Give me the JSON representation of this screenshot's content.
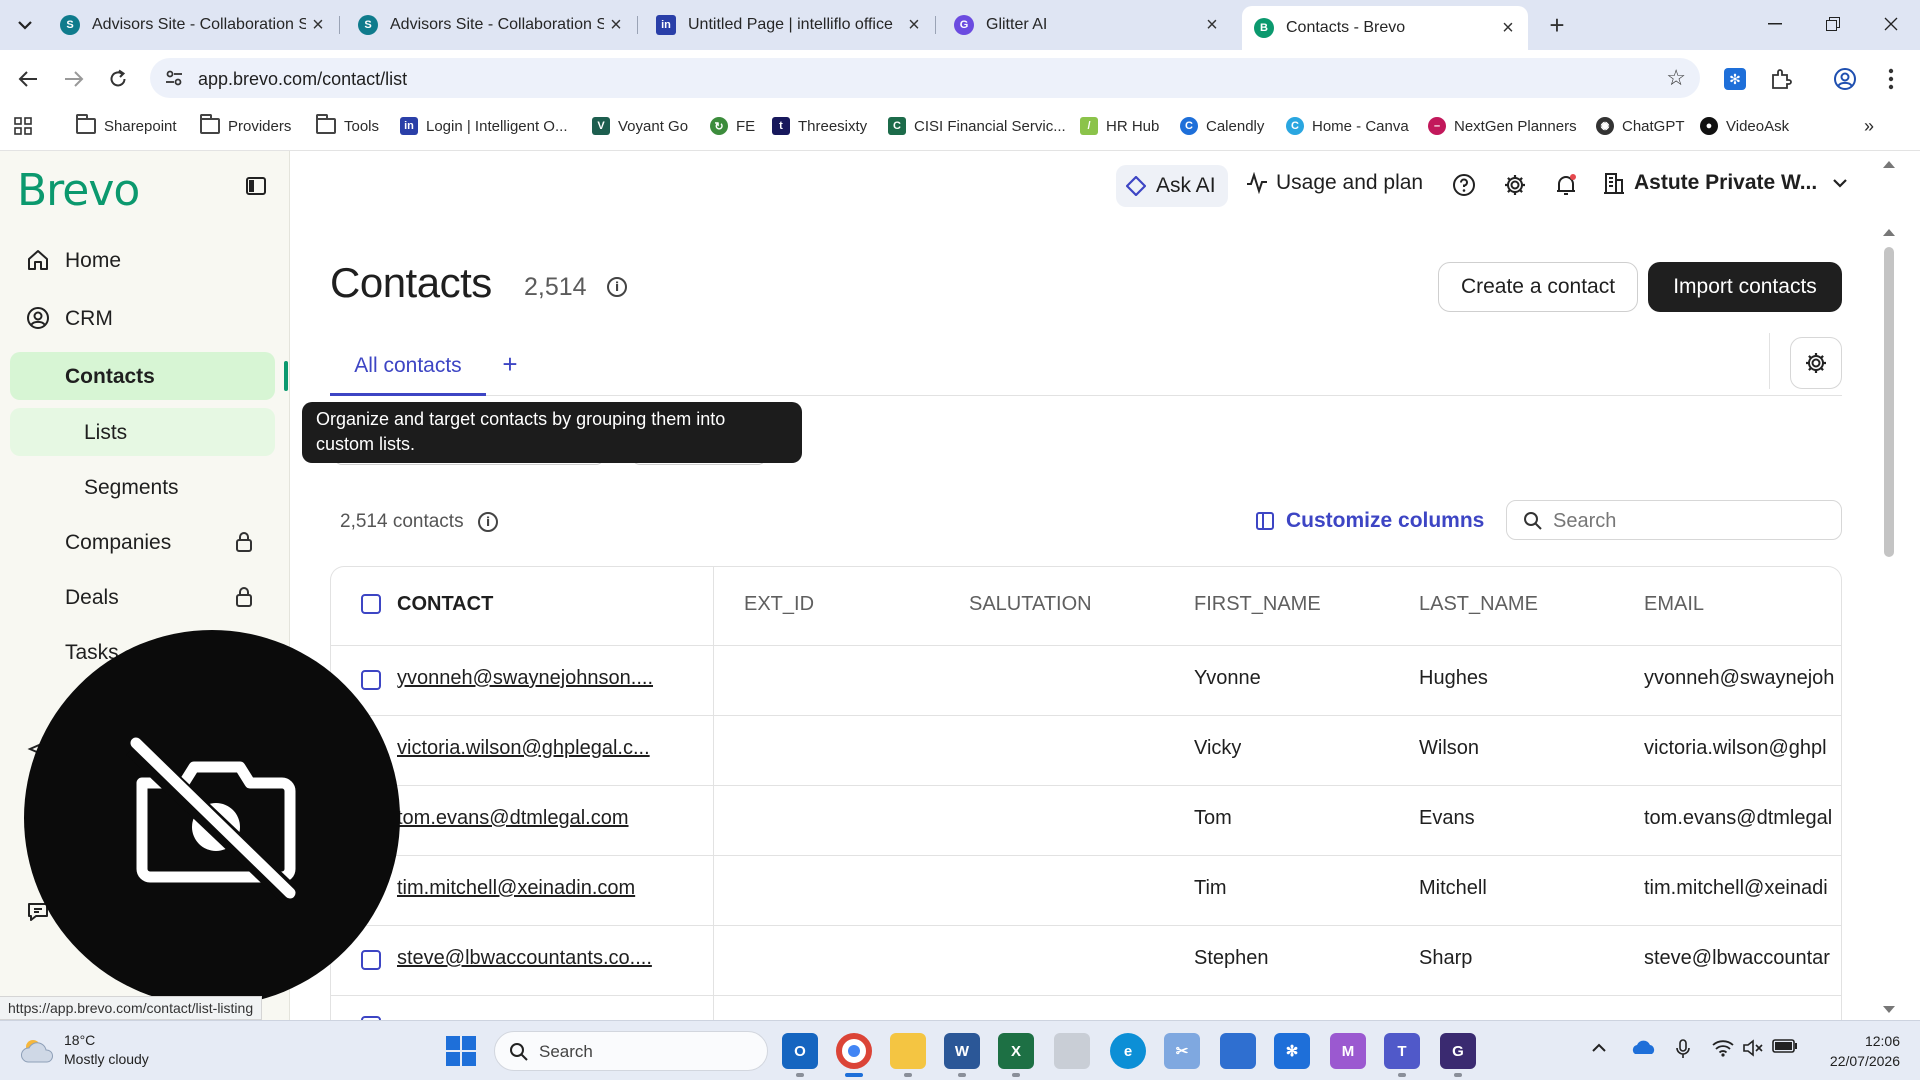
{
  "browser": {
    "tabs": [
      {
        "title": "Advisors Site - Collaboration Site",
        "active": false
      },
      {
        "title": "Advisors Site - Collaboration Site",
        "active": false
      },
      {
        "title": "Untitled Page | intelliflo office",
        "active": false
      },
      {
        "title": "Glitter AI",
        "active": false
      },
      {
        "title": "Contacts - Brevo",
        "active": true
      }
    ],
    "url": "app.brevo.com/contact/list",
    "bookmarks": [
      "Sharepoint",
      "Providers",
      "Tools",
      "Login | Intelligent O...",
      "Voyant Go",
      "FE",
      "Threesixty",
      "CISI Financial Servic...",
      "HR Hub",
      "Calendly",
      "Home - Canva",
      "NextGen Planners",
      "ChatGPT",
      "VideoAsk"
    ],
    "status_url": "https://app.brevo.com/contact/list-listing"
  },
  "colors": {
    "brand": "#0b996e",
    "accent": "#3d45c4",
    "selected_nav": "#d7f5d4"
  },
  "sidebar": {
    "logo": "Brevo",
    "items": [
      {
        "label": "Home",
        "icon": "home-icon"
      },
      {
        "label": "CRM",
        "icon": "user-circle-icon"
      },
      {
        "label": "Contacts",
        "selected": true
      },
      {
        "label": "Lists"
      },
      {
        "label": "Segments"
      },
      {
        "label": "Companies",
        "locked": true
      },
      {
        "label": "Deals",
        "locked": true
      },
      {
        "label": "Tasks"
      }
    ]
  },
  "header": {
    "ask_ai": "Ask AI",
    "usage": "Usage and plan",
    "account": "Astute Private W..."
  },
  "page": {
    "title": "Contacts",
    "count": "2,514",
    "create_button": "Create a contact",
    "import_button": "Import contacts",
    "tab_all": "All contacts",
    "tab_add": "+",
    "tooltip": "Organize and target contacts by grouping them into custom lists.",
    "contacts_count": "2,514 contacts",
    "customize_columns": "Customize columns",
    "search_placeholder": "Search"
  },
  "table": {
    "columns": [
      "CONTACT",
      "EXT_ID",
      "SALUTATION",
      "FIRST_NAME",
      "LAST_NAME",
      "EMAIL"
    ],
    "rows": [
      {
        "contact": "yvonneh@swaynejohnson....",
        "ext_id": "",
        "salutation": "",
        "first_name": "Yvonne",
        "last_name": "Hughes",
        "email": "yvonneh@swaynejoh"
      },
      {
        "contact": "victoria.wilson@ghplegal.c...",
        "ext_id": "",
        "salutation": "",
        "first_name": "Vicky",
        "last_name": "Wilson",
        "email": "victoria.wilson@ghpl"
      },
      {
        "contact": "tom.evans@dtmlegal.com",
        "ext_id": "",
        "salutation": "",
        "first_name": "Tom",
        "last_name": "Evans",
        "email": "tom.evans@dtmlegal"
      },
      {
        "contact": "tim.mitchell@xeinadin.com",
        "ext_id": "",
        "salutation": "",
        "first_name": "Tim",
        "last_name": "Mitchell",
        "email": "tim.mitchell@xeinadi"
      },
      {
        "contact": "steve@lbwaccountants.co....",
        "ext_id": "",
        "salutation": "",
        "first_name": "Stephen",
        "last_name": "Sharp",
        "email": "steve@lbwaccountar"
      }
    ]
  },
  "taskbar": {
    "temperature": "18°C",
    "weather": "Mostly cloudy",
    "search": "Search",
    "time": "12:06",
    "date": "22/07/2026"
  }
}
